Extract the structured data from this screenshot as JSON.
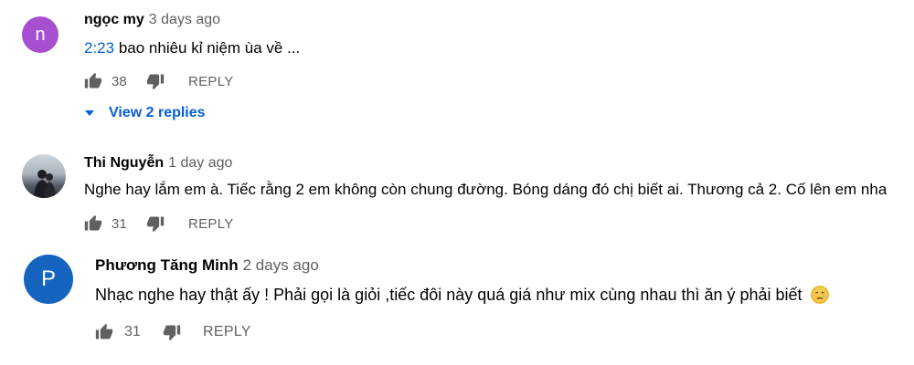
{
  "comments": [
    {
      "author": "ngọc my",
      "time": "3 days ago",
      "avatar_letter": "n",
      "avatar_color": "#a64fd0",
      "timestamp_link": "2:23",
      "text": " bao nhiêu kỉ niệm ùa về ...",
      "likes": "38",
      "reply_label": "REPLY",
      "view_replies": "View 2 replies"
    },
    {
      "author": "Thi Nguyễn",
      "time": "1 day ago",
      "avatar_kind": "photo",
      "text": "Nghe hay lắm em à. Tiếc rằng 2 em không còn chung đường. Bóng dáng đó chị biết ai. Thương cả 2. Cố lên em nha",
      "likes": "31",
      "reply_label": "REPLY"
    },
    {
      "author": "Phương Tăng Minh",
      "time": "2 days ago",
      "avatar_letter": "P",
      "avatar_color": "#1565c0",
      "text": "Nhạc nghe hay thật ấy !  Phải gọi là giỏi ,tiếc đôi này quá giá như mix cùng nhau thì ăn ý phải biết",
      "emoji": "crying-face",
      "likes": "31",
      "reply_label": "REPLY"
    }
  ]
}
